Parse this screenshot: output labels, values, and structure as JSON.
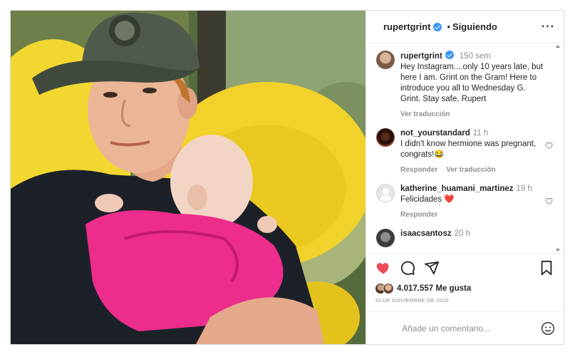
{
  "header": {
    "username": "rupertgrint",
    "separator": "•",
    "follow_status": "Siguiendo",
    "more_label": "···"
  },
  "caption": {
    "username": "rupertgrint",
    "time": "150 sem",
    "text": "Hey Instagram....only 10 years late, but here I am. Grint on the Gram! Here to introduce you all to Wednesday G. Grint. Stay safe, Rupert",
    "translate": "Ver traducción"
  },
  "comments": [
    {
      "username": "not_yourstandard",
      "time": "11 h",
      "text": "I didn't know hermione was pregnant, congrats!😂",
      "reply": "Responder",
      "translate": "Ver traducción"
    },
    {
      "username": "katherine_huamani_martinez",
      "time": "19 h",
      "text": "Felicidades ❤️",
      "reply": "Responder"
    },
    {
      "username": "isaacsantosz",
      "time": "20 h",
      "text": ""
    }
  ],
  "likes": {
    "count": "4.017.557",
    "label": "Me gusta"
  },
  "date": "10 DE NOVIEMBRE DE 2020",
  "add_comment": {
    "placeholder": "Añade un comentario..."
  },
  "colors": {
    "like_red": "#ed4956",
    "verified_blue": "#3897f0",
    "muted_text": "#8e8e8e"
  },
  "icons": {
    "like": "heart-filled-icon",
    "comment": "comment-icon",
    "share": "paper-plane-icon",
    "save": "bookmark-icon",
    "emoji": "smiley-icon"
  }
}
